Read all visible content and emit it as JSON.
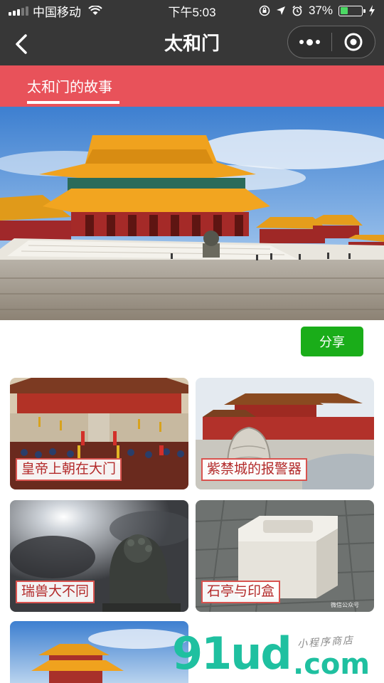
{
  "status_bar": {
    "carrier": "中国移动",
    "time": "下午5:03",
    "battery": "37%",
    "battery_level": 0.37
  },
  "nav": {
    "title": "太和门"
  },
  "tab": {
    "label": "太和门的故事"
  },
  "share": {
    "label": "分享"
  },
  "cards": [
    {
      "label": "皇帝上朝在大门"
    },
    {
      "label": "紫禁城的报警器"
    },
    {
      "label": "瑞兽大不同"
    },
    {
      "label": "石亭与印盒"
    }
  ],
  "card_watermark": "微信公众号",
  "watermark": {
    "logo": "91ud",
    "domain": ".com",
    "tagline": "小程序商店"
  },
  "colors": {
    "nav_bg": "#373737",
    "tab_bg": "#e8525a",
    "share_bg": "#1aad19"
  }
}
